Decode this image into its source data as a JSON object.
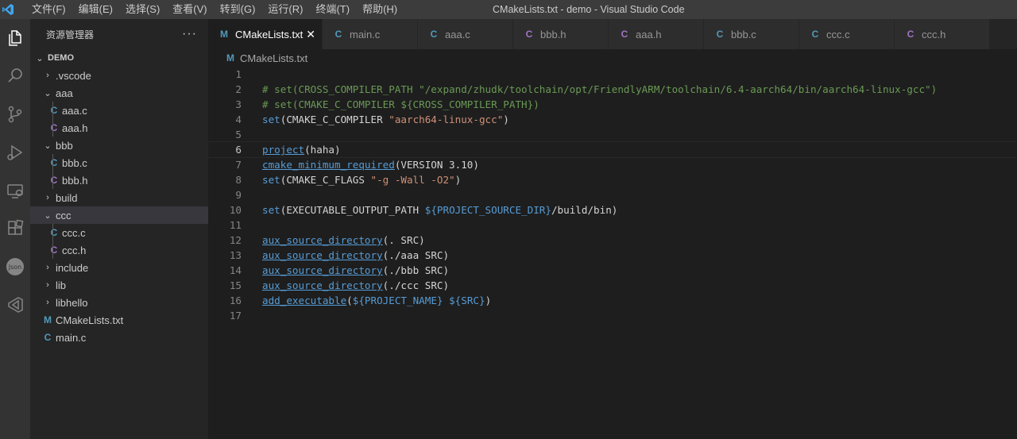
{
  "window": {
    "title": "CMakeLists.txt - demo - Visual Studio Code"
  },
  "menu": [
    "文件(F)",
    "编辑(E)",
    "选择(S)",
    "查看(V)",
    "转到(G)",
    "运行(R)",
    "终端(T)",
    "帮助(H)"
  ],
  "sidebar": {
    "title": "资源管理器",
    "more": "···",
    "root": "DEMO",
    "items": [
      {
        "label": ".vscode",
        "type": "folder",
        "open": false,
        "depth": 0
      },
      {
        "label": "aaa",
        "type": "folder",
        "open": true,
        "depth": 0
      },
      {
        "label": "aaa.c",
        "type": "c",
        "depth": 1
      },
      {
        "label": "aaa.h",
        "type": "h",
        "depth": 1
      },
      {
        "label": "bbb",
        "type": "folder",
        "open": true,
        "depth": 0
      },
      {
        "label": "bbb.c",
        "type": "c",
        "depth": 1
      },
      {
        "label": "bbb.h",
        "type": "h",
        "depth": 1
      },
      {
        "label": "build",
        "type": "folder",
        "open": false,
        "depth": 0
      },
      {
        "label": "ccc",
        "type": "folder",
        "open": true,
        "depth": 0,
        "selected": true
      },
      {
        "label": "ccc.c",
        "type": "c",
        "depth": 1
      },
      {
        "label": "ccc.h",
        "type": "h",
        "depth": 1
      },
      {
        "label": "include",
        "type": "folder",
        "open": false,
        "depth": 0
      },
      {
        "label": "lib",
        "type": "folder",
        "open": false,
        "depth": 0
      },
      {
        "label": "libhello",
        "type": "folder",
        "open": false,
        "depth": 0
      },
      {
        "label": "CMakeLists.txt",
        "type": "m",
        "depth": 0
      },
      {
        "label": "main.c",
        "type": "c",
        "depth": 0
      }
    ]
  },
  "tabs": [
    {
      "label": "CMakeLists.txt",
      "icon": "M",
      "type": "m",
      "active": true
    },
    {
      "label": "main.c",
      "icon": "C",
      "type": "c"
    },
    {
      "label": "aaa.c",
      "icon": "C",
      "type": "c"
    },
    {
      "label": "bbb.h",
      "icon": "C",
      "type": "h"
    },
    {
      "label": "aaa.h",
      "icon": "C",
      "type": "h"
    },
    {
      "label": "bbb.c",
      "icon": "C",
      "type": "c"
    },
    {
      "label": "ccc.c",
      "icon": "C",
      "type": "c"
    },
    {
      "label": "ccc.h",
      "icon": "C",
      "type": "h"
    }
  ],
  "close_glyph": "✕",
  "icons": {
    "m": "M",
    "c": "C",
    "h": "C",
    "chevron_right": "›",
    "chevron_down": "⌄"
  },
  "breadcrumb": {
    "icon": "M",
    "file": "CMakeLists.txt"
  },
  "editor": {
    "current_line": 6,
    "lines": [
      [],
      [
        [
          "c-comment",
          "# set(CROSS_COMPILER_PATH \"/expand/zhudk/toolchain/opt/FriendlyARM/toolchain/6.4-aarch64/bin/aarch64-linux-gcc\")"
        ]
      ],
      [
        [
          "c-comment",
          "# set(CMAKE_C_COMPILER ${CROSS_COMPILER_PATH})"
        ]
      ],
      [
        [
          "c-func",
          "set"
        ],
        [
          "c-plain",
          "(CMAKE_C_COMPILER "
        ],
        [
          "c-str",
          "\"aarch64-linux-gcc\""
        ],
        [
          "c-plain",
          ")"
        ]
      ],
      [],
      [
        [
          "c-func-u",
          "project"
        ],
        [
          "c-plain",
          "(haha)"
        ]
      ],
      [
        [
          "c-func-u",
          "cmake_minimum_required"
        ],
        [
          "c-plain",
          "(VERSION 3.10)"
        ]
      ],
      [
        [
          "c-func",
          "set"
        ],
        [
          "c-plain",
          "(CMAKE_C_FLAGS "
        ],
        [
          "c-str",
          "\"-g -Wall -O2\""
        ],
        [
          "c-plain",
          ")"
        ]
      ],
      [],
      [
        [
          "c-func",
          "set"
        ],
        [
          "c-plain",
          "(EXECUTABLE_OUTPUT_PATH "
        ],
        [
          "c-var",
          "${PROJECT_SOURCE_DIR}"
        ],
        [
          "c-plain",
          "/build/bin)"
        ]
      ],
      [],
      [
        [
          "c-func-u",
          "aux_source_directory"
        ],
        [
          "c-plain",
          "(. SRC)"
        ]
      ],
      [
        [
          "c-func-u",
          "aux_source_directory"
        ],
        [
          "c-plain",
          "(./aaa SRC)"
        ]
      ],
      [
        [
          "c-func-u",
          "aux_source_directory"
        ],
        [
          "c-plain",
          "(./bbb SRC)"
        ]
      ],
      [
        [
          "c-func-u",
          "aux_source_directory"
        ],
        [
          "c-plain",
          "(./ccc SRC)"
        ]
      ],
      [
        [
          "c-func-u",
          "add_executable"
        ],
        [
          "c-plain",
          "("
        ],
        [
          "c-var",
          "${PROJECT_NAME}"
        ],
        [
          "c-plain",
          " "
        ],
        [
          "c-var",
          "${SRC}"
        ],
        [
          "c-plain",
          ")"
        ]
      ],
      []
    ]
  },
  "colors": {
    "accent": "#0078d4",
    "titlebar": "#3c3c3c",
    "activitybar": "#333333",
    "sidebar": "#252526",
    "editor": "#1e1e1e"
  }
}
